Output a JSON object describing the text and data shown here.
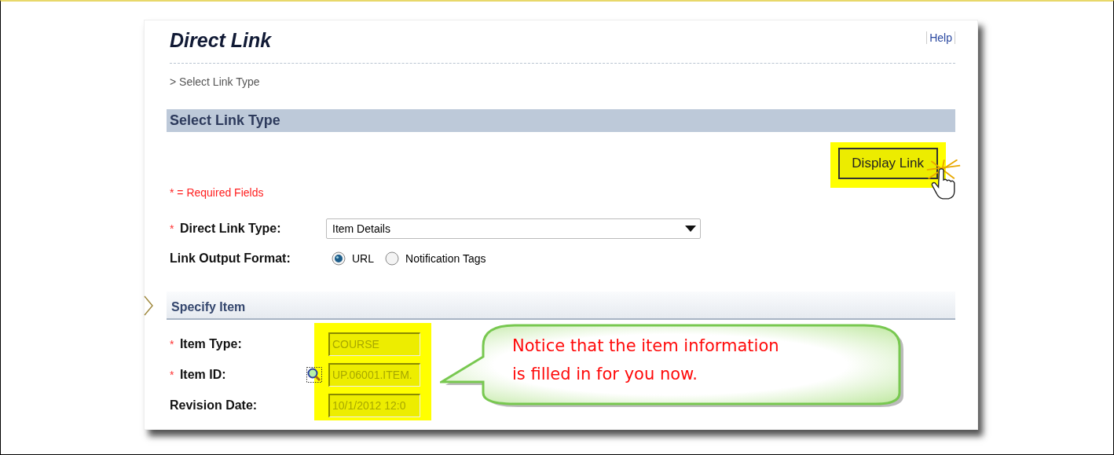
{
  "title": "Direct Link",
  "help_link": "Help",
  "breadcrumb": "> Select Link Type",
  "section": "Select Link Type",
  "display_button": {
    "label": "Display Link",
    "highlighted": true
  },
  "required_mark": "*",
  "required_note": "* = Required Fields",
  "link_type": {
    "label": "Direct Link Type:",
    "required": true,
    "value": "Item Details"
  },
  "output_format": {
    "label": "Link Output Format:",
    "options": [
      {
        "label": "URL",
        "selected": true
      },
      {
        "label": "Notification Tags",
        "selected": false
      }
    ]
  },
  "specify_item": {
    "title": "Specify Item",
    "highlighted": true,
    "fields": [
      {
        "label": "Item Type:",
        "required": true,
        "value": "COURSE",
        "disabled": true,
        "kind": "text"
      },
      {
        "label": "Item ID:",
        "required": true,
        "value": "UP.06001.ITEM.",
        "disabled": true,
        "kind": "lookup"
      },
      {
        "label": "Revision Date:",
        "required": false,
        "value": "10/1/2012 12:0",
        "disabled": true,
        "kind": "text"
      }
    ]
  },
  "callout": "Notice that the item information is filled in for you now."
}
